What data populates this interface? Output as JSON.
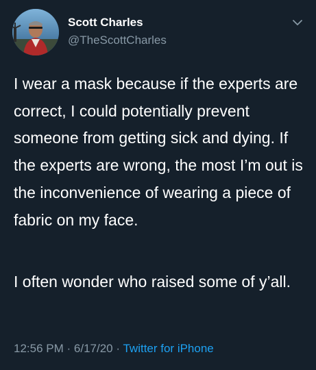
{
  "author": {
    "name": "Scott Charles",
    "handle": "@TheScottCharles"
  },
  "tweet": {
    "paragraphs": [
      "I wear a mask because if the experts are correct, I could potentially prevent someone from getting sick and dying. If the experts are wrong, the most I’m out is the inconvenience of wearing a piece of fabric on my face.",
      "I often wonder who raised some of y’all."
    ]
  },
  "meta": {
    "time": "12:56 PM",
    "date": "6/17/20",
    "separator": "·",
    "source": "Twitter for iPhone"
  },
  "icons": {
    "menu": "chevron-down-icon"
  },
  "colors": {
    "background": "#15202b",
    "text": "#ffffff",
    "secondary": "#8899a6",
    "link": "#1da1f2"
  }
}
